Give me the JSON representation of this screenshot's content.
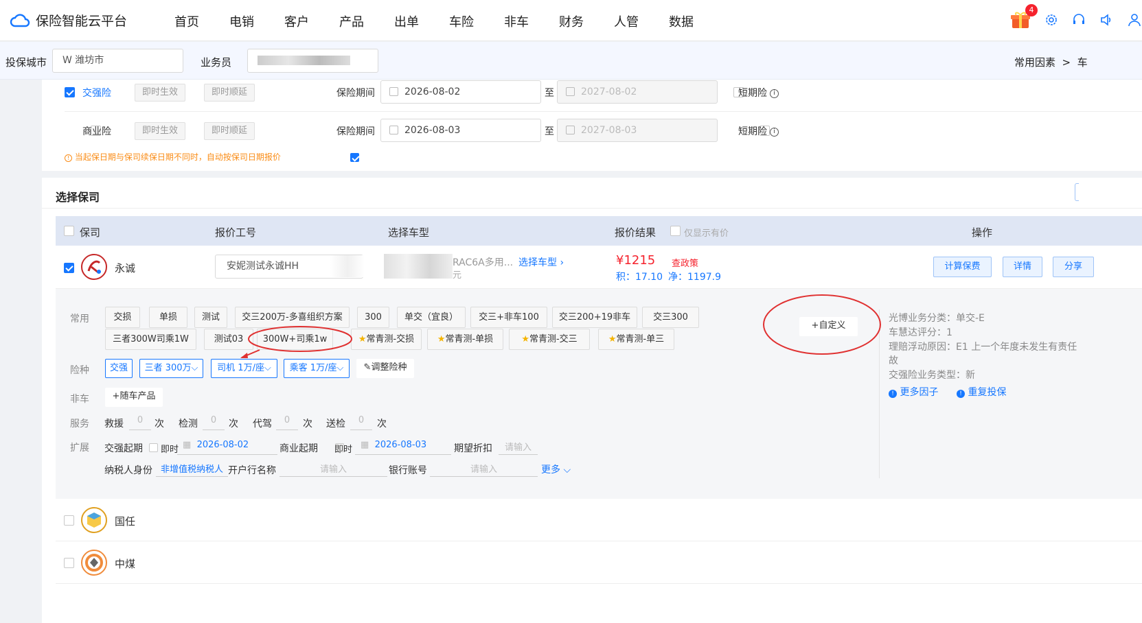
{
  "header": {
    "app_title": "保险智能云平台",
    "nav": [
      "首页",
      "电销",
      "客户",
      "产品",
      "出单",
      "车险",
      "非车",
      "财务",
      "人管",
      "数据"
    ],
    "notification_count": "4"
  },
  "filter": {
    "city_label": "投保城市",
    "city_value": "W 潍坊市",
    "agent_label": "业务员",
    "common_factors": "常用因素",
    "common_factors_tail": "车"
  },
  "insurance": {
    "jq_label": "交强险",
    "sy_label": "商业险",
    "immediate_effect": "即时生效",
    "immediate_delay": "即时顺延",
    "period_label": "保险期间",
    "to": "至",
    "jq_start": "2026-08-02",
    "jq_end": "2027-08-02",
    "sy_start": "2026-08-03",
    "sy_end": "2027-08-03",
    "short_term": "短期险",
    "notice": "当起保日期与保司续保日期不同时，自动按保司日期报价"
  },
  "select_company": {
    "title": "选择保司",
    "columns": {
      "company": "保司",
      "quote_code": "报价工号",
      "vehicle": "选择车型",
      "result": "报价结果",
      "only_price": "仅显示有价",
      "actions": "操作"
    }
  },
  "yongcheng": {
    "name": "永诚",
    "quote_code": "安妮测试永诚HH",
    "vehicle_text": "RAC6A多用...",
    "vehicle_sub": "元",
    "select_vehicle": "选择车型",
    "price": "¥1215",
    "check_policy": "查政策",
    "points": "积：17.10",
    "net": "净：1197.9",
    "btn_calc": "计算保费",
    "btn_detail": "详情",
    "btn_share": "分享"
  },
  "expand": {
    "common_label": "常用",
    "common_row1": [
      "交损",
      "单损",
      "测试",
      "交三200万-多喜组织方案",
      "300",
      "单交（宜良）",
      "交三+非车100",
      "交三200+19非车",
      "交三300"
    ],
    "common_row2": [
      "三者300W司乘1W",
      "测试03",
      "300W+司乘1w",
      "常青测-交损",
      "常青测-单损",
      "常青测-交三",
      "常青测-单三"
    ],
    "custom": "+自定义",
    "risk_label": "险种",
    "risks": [
      "交强",
      "三者 300万",
      "司机 1万/座",
      "乘客 1万/座"
    ],
    "adjust": "调整险种",
    "nonauto_label": "非车",
    "add_product": "+随车产品",
    "service_label": "服务",
    "services": [
      "救援",
      "检测",
      "代驾",
      "送检"
    ],
    "service_zero": "0",
    "times": "次",
    "extend_label": "扩展",
    "jq_start_label": "交强起期",
    "sy_start_label": "商业起期",
    "immediate": "即时",
    "jq_date": "2026-08-02",
    "sy_date": "2026-08-03",
    "expected_discount": "期望折扣",
    "please_input": "请输入",
    "taxpayer_label": "纳税人身份",
    "taxpayer_value": "非增值税纳税人",
    "bank_name": "开户行名称",
    "bank_account": "银行账号",
    "more": "更多"
  },
  "side": {
    "line1": "光博业务分类：单交-E",
    "line2": "车慧达评分：1",
    "line3": "理赔浮动原因：E1 上一个年度未发生有责任",
    "line3b": "故",
    "line4": "交强险业务类型：新",
    "more_factors": "更多因子",
    "repeat": "重复投保"
  },
  "others": [
    {
      "name": "国任"
    },
    {
      "name": "中煤"
    }
  ],
  "colors": {
    "primary": "#1677ff",
    "price_red": "#f5222d",
    "warn_orange": "#fa8c16",
    "annotation_red": "#e03131"
  }
}
